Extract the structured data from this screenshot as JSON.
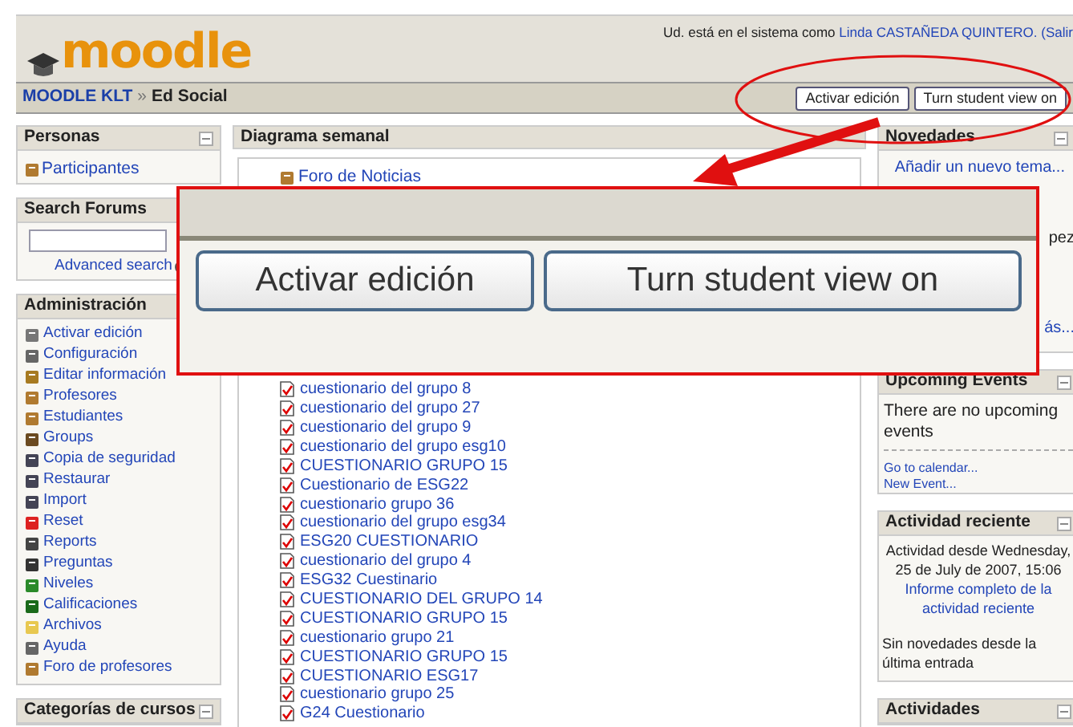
{
  "header": {
    "logo": "moodle",
    "login_prefix": "Ud. está en el sistema como",
    "user": "Linda CASTAÑEDA QUINTERO.",
    "logout": "(Salir"
  },
  "navbar": {
    "breadcrumb": [
      {
        "label": "MOODLE KLT",
        "link": true
      },
      {
        "label": "Ed Social",
        "link": false
      }
    ],
    "separator": "»",
    "buttons": [
      "Activar edición",
      "Turn student view on"
    ]
  },
  "left": {
    "personas": {
      "title": "Personas",
      "items": [
        "Participantes"
      ]
    },
    "search": {
      "title": "Search Forums",
      "link": "Advanced search"
    },
    "admin": {
      "title": "Administración",
      "items": [
        "Activar edición",
        "Configuración",
        "Editar información",
        "Profesores",
        "Estudiantes",
        "Groups",
        "Copia de seguridad",
        "Restaurar",
        "Import",
        "Reset",
        "Reports",
        "Preguntas",
        "Niveles",
        "Calificaciones",
        "Archivos",
        "Ayuda",
        "Foro de profesores"
      ]
    },
    "categories": {
      "title": "Categorías de cursos"
    }
  },
  "center": {
    "title": "Diagrama semanal",
    "forum": "Foro de Noticias",
    "quizzes": [
      "cuestionario del grupo 8",
      "cuestionario del grupo 27",
      "cuestionario del grupo 9",
      "cuestionario del grupo esg10",
      "CUESTIONARIO GRUPO 15",
      "Cuestionario de ESG22",
      "cuestionario grupo 36",
      "cuestionario del grupo esg34",
      "ESG20 CUESTIONARIO",
      "cuestionario del grupo 4",
      "ESG32 Cuestinario",
      "CUESTIONARIO DEL GRUPO 14",
      "CUESTIONARIO GRUPO 15",
      "cuestionario grupo 21",
      "CUESTIONARIO GRUPO 15",
      "CUESTIONARIO ESG17",
      "cuestionario grupo 25",
      "G24 Cuestionario"
    ]
  },
  "right": {
    "news": {
      "title": "Novedades",
      "add": "Añadir un nuevo tema...",
      "fragment_1": "pez",
      "fragment_2": "ás..."
    },
    "events": {
      "title": "Upcoming Events",
      "text": "There are no upcoming events",
      "links": [
        "Go to calendar...",
        "New Event..."
      ]
    },
    "recent": {
      "title": "Actividad reciente",
      "since": "Actividad desde Wednesday, 25 de July de 2007, 15:06",
      "report": "Informe completo de la actividad reciente",
      "none": "Sin novedades desde la última entrada"
    },
    "activities": {
      "title": "Actividades"
    }
  },
  "zoom_callout": {
    "buttons": [
      "Activar edición",
      "Turn student view on"
    ]
  }
}
